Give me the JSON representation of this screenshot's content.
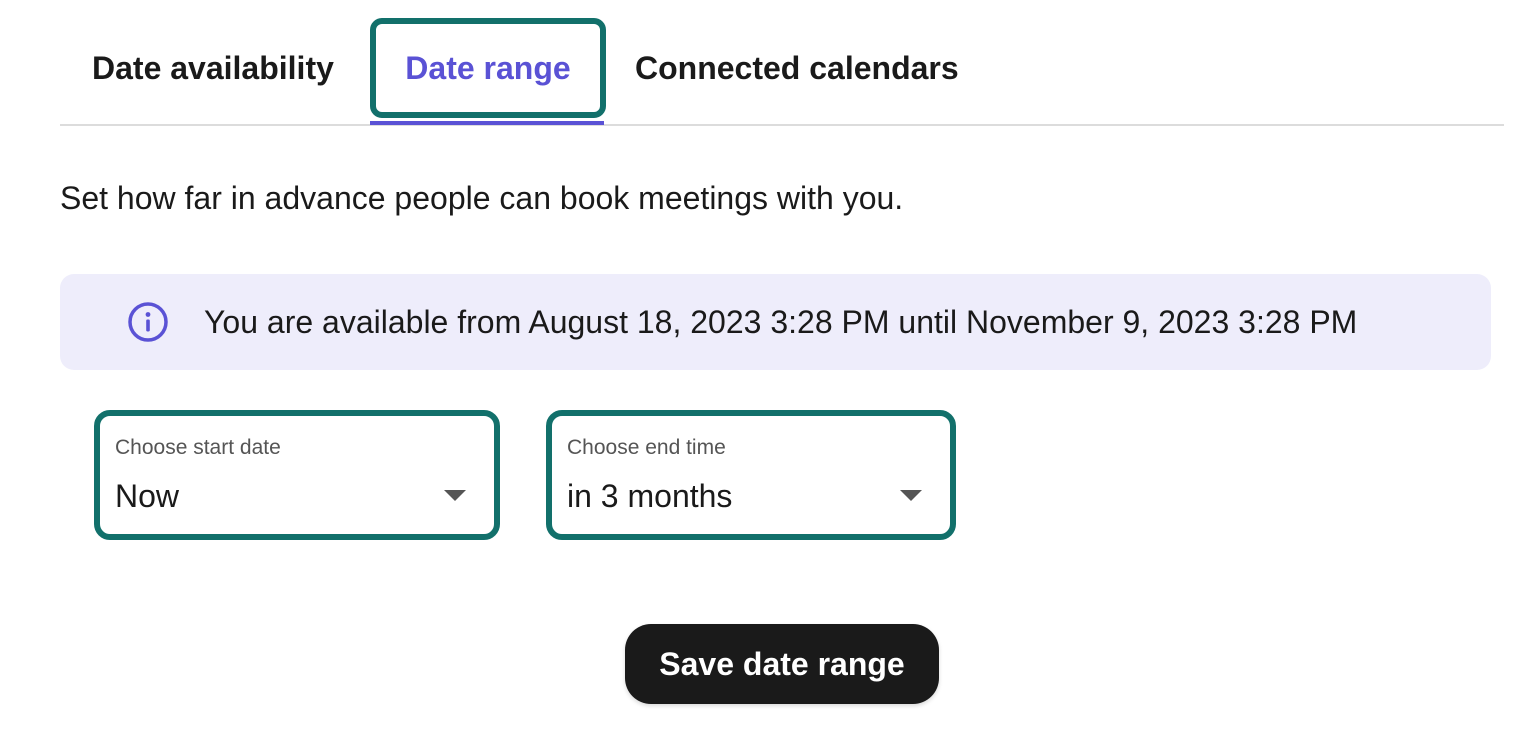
{
  "tabs": {
    "availability": "Date availability",
    "range": "Date range",
    "calendars": "Connected calendars",
    "active": "range"
  },
  "description": "Set how far in advance people can book meetings with you.",
  "info_banner": {
    "icon": "info-icon",
    "text": "You are available from August 18, 2023 3:28 PM until November 9, 2023 3:28 PM"
  },
  "start_select": {
    "label": "Choose start date",
    "value": "Now"
  },
  "end_select": {
    "label": "Choose end time",
    "value": "in 3 months"
  },
  "save_button": "Save date range",
  "colors": {
    "accent": "#5a52d5",
    "focus_ring": "#12706b",
    "banner_bg": "#eeedfb",
    "button_bg": "#1a1a1a"
  }
}
